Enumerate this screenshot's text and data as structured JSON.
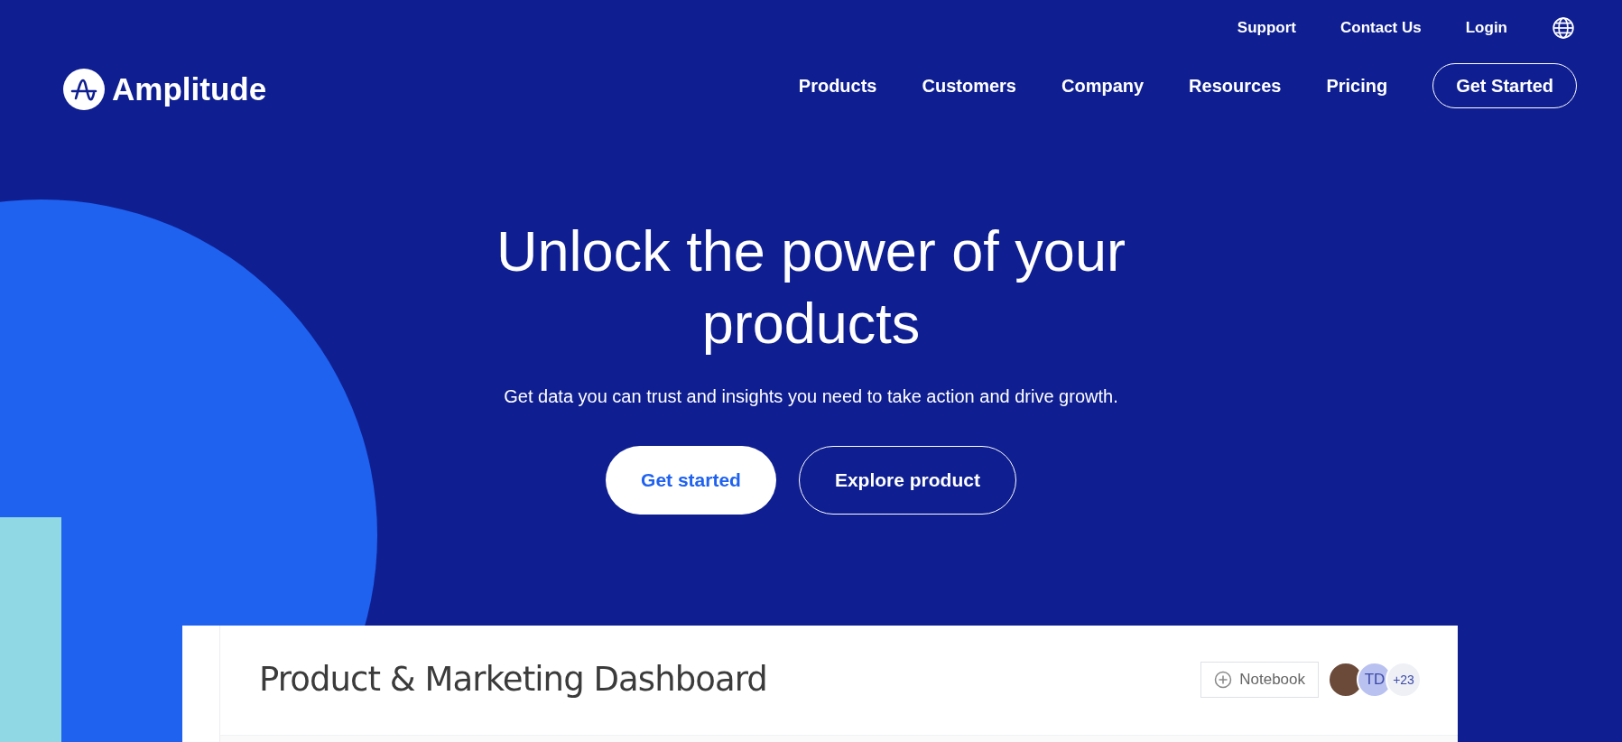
{
  "brand": {
    "name": "Amplitude"
  },
  "utility_nav": [
    "Support",
    "Contact Us",
    "Login"
  ],
  "main_nav": [
    "Products",
    "Customers",
    "Company",
    "Resources",
    "Pricing"
  ],
  "header_cta": "Get Started",
  "hero": {
    "title": "Unlock the power of your products",
    "subtitle": "Get data you can trust and insights you need to take action and drive growth.",
    "buttons": [
      {
        "label": "Get started",
        "kind": "primary"
      },
      {
        "label": "Explore product",
        "kind": "outline"
      }
    ]
  },
  "dashboard": {
    "title": "Product & Marketing Dashboard",
    "notebook_button": "Notebook",
    "avatars": [
      {
        "kind": "photo"
      },
      {
        "kind": "initials",
        "text": "TD"
      },
      {
        "kind": "count",
        "text": "+23"
      }
    ]
  }
}
